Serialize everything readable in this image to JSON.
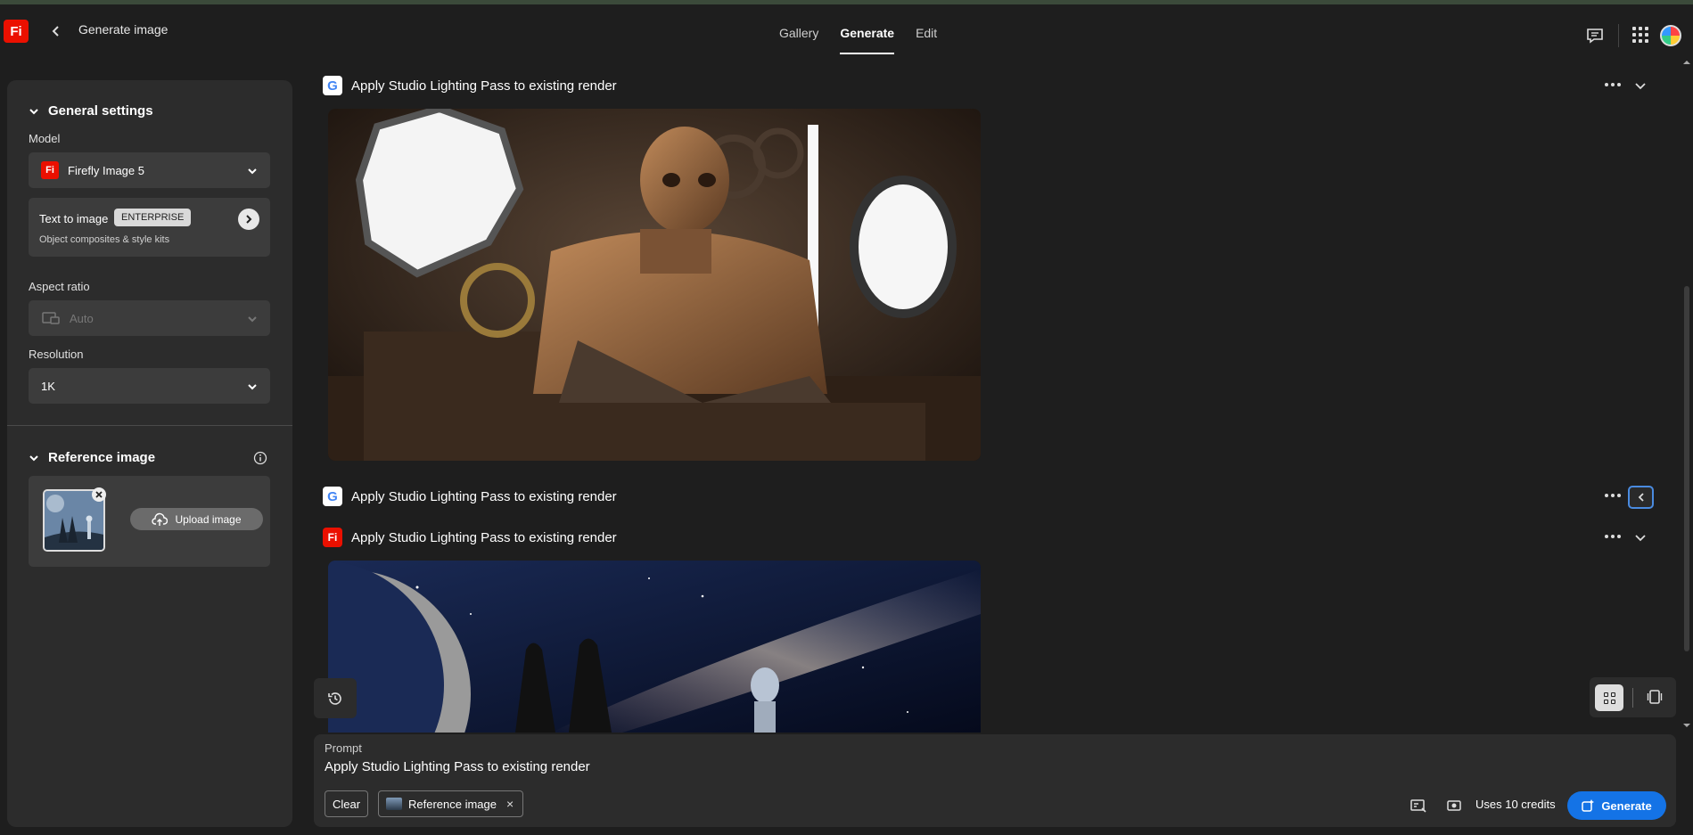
{
  "app": {
    "logo": "Fi",
    "title": "Generate image"
  },
  "nav": {
    "tabs": [
      "Gallery",
      "Generate",
      "Edit"
    ],
    "active": "Generate"
  },
  "sidebar": {
    "general": {
      "heading": "General settings",
      "model_label": "Model",
      "model_value": "Firefly Image 5",
      "model_logo": "Fi",
      "mode_title": "Text to image",
      "mode_badge": "ENTERPRISE",
      "mode_subtitle": "Object composites & style kits",
      "aspect_label": "Aspect ratio",
      "aspect_value": "Auto",
      "resolution_label": "Resolution",
      "resolution_value": "1K"
    },
    "reference": {
      "heading": "Reference image",
      "upload_label": "Upload image"
    }
  },
  "results": [
    {
      "title": "Apply Studio Lighting Pass to existing render",
      "source": "G"
    },
    {
      "title": "Apply Studio Lighting Pass to existing render",
      "source": "G"
    },
    {
      "title": "Apply Studio Lighting Pass to existing render",
      "source": "Fi"
    }
  ],
  "prompt": {
    "label": "Prompt",
    "text": "Apply Studio Lighting Pass to existing render",
    "clear_label": "Clear",
    "chip_label": "Reference image",
    "chip_close": "×",
    "credits": "Uses 10 credits",
    "generate_label": "Generate"
  },
  "colors": {
    "accent": "#1473e6",
    "brand": "#eb1000",
    "panel": "#2c2c2c",
    "background": "#1e1e1e"
  }
}
